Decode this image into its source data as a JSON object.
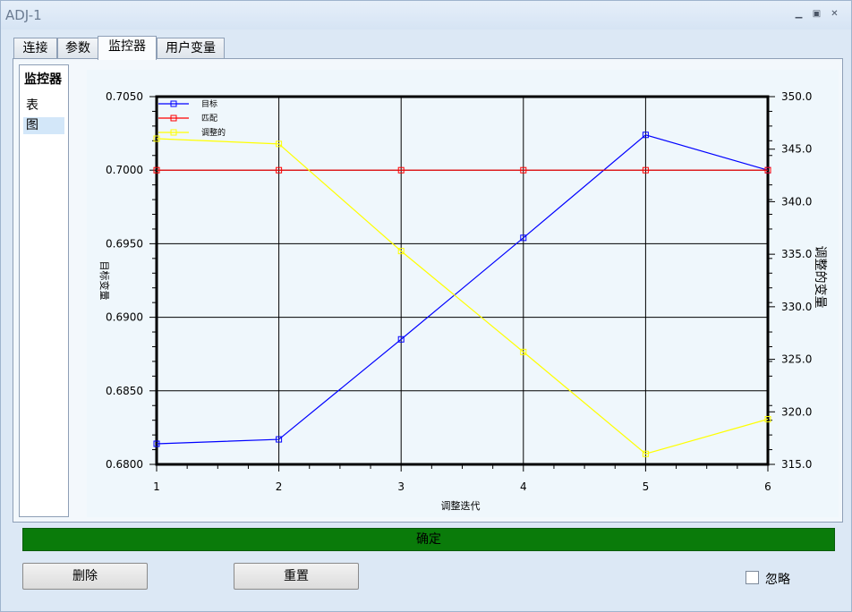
{
  "window": {
    "title": "ADJ-1"
  },
  "tabs": [
    {
      "label": "连接"
    },
    {
      "label": "参数"
    },
    {
      "label": "监控器"
    },
    {
      "label": "用户变量"
    }
  ],
  "sidebar": {
    "title": "监控器",
    "items": [
      {
        "label": "表"
      },
      {
        "label": "图"
      }
    ],
    "selected": "图"
  },
  "chart_data": {
    "type": "line",
    "xlabel": "调整迭代",
    "ylabel": "目标变量",
    "y2label": "调整的变量",
    "x": [
      1,
      2,
      3,
      4,
      5,
      6
    ],
    "xlim": [
      1,
      6
    ],
    "ylim": [
      0.68,
      0.705
    ],
    "y2lim": [
      315.0,
      350.0
    ],
    "x_ticks": [
      "1",
      "2",
      "3",
      "4",
      "5",
      "6"
    ],
    "y_ticks": [
      "0.6800",
      "0.6850",
      "0.6900",
      "0.6950",
      "0.7000",
      "0.7050"
    ],
    "y2_ticks": [
      "315.0",
      "320.0",
      "325.0",
      "330.0",
      "335.0",
      "340.0",
      "345.0",
      "350.0"
    ],
    "grid": true,
    "legend_position": "top-left",
    "series": [
      {
        "name": "目标",
        "axis": "left",
        "color": "#0000ff",
        "values": [
          0.6814,
          0.6817,
          0.6885,
          0.6954,
          0.7024,
          0.7
        ]
      },
      {
        "name": "匹配",
        "axis": "left",
        "color": "#ff0000",
        "values": [
          0.7,
          0.7,
          0.7,
          0.7,
          0.7,
          0.7
        ]
      },
      {
        "name": "调整的",
        "axis": "right",
        "color": "#ffff00",
        "values": [
          346.0,
          345.5,
          335.3,
          325.7,
          316.0,
          319.3
        ]
      }
    ]
  },
  "status_bar": {
    "text": "确定",
    "color": "#0a7b0a"
  },
  "buttons": {
    "delete": "删除",
    "reset": "重置"
  },
  "ignore": {
    "label": "忽略",
    "checked": false
  }
}
